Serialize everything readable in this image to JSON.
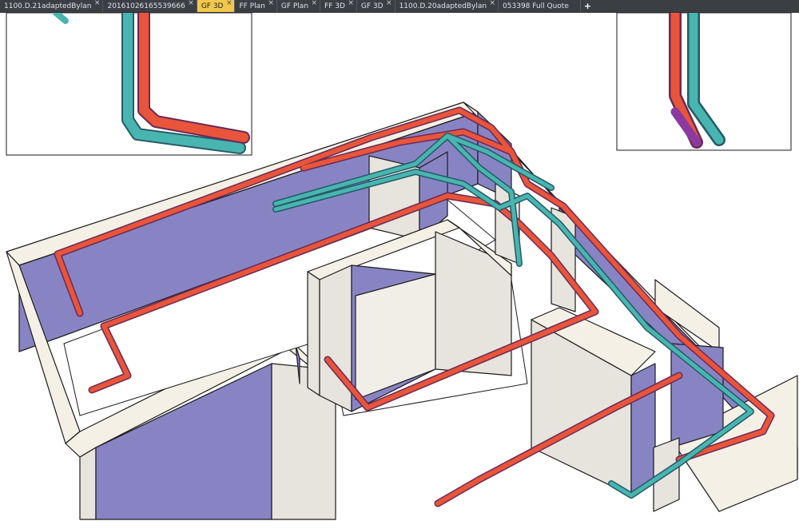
{
  "tabs": [
    {
      "label": "1100.D.21adaptedBylan",
      "active": false
    },
    {
      "label": "20161026165539666",
      "active": false
    },
    {
      "label": "GF 3D",
      "active": true
    },
    {
      "label": "FF Plan",
      "active": false
    },
    {
      "label": "GF Plan",
      "active": false
    },
    {
      "label": "FF 3D",
      "active": false
    },
    {
      "label": "GF 3D",
      "active": false
    },
    {
      "label": "1100.D.20adaptedBylan",
      "active": false
    },
    {
      "label": "053398 Full Quote",
      "active": false
    }
  ],
  "close_glyph": "×",
  "add_tab_glyph": "+",
  "icons": {
    "close": "close-icon",
    "add": "plus-icon"
  },
  "colors": {
    "tabbar_bg": "#3b3f44",
    "active_tab": "#f2c94c",
    "wall_top": "#f4f0e6",
    "wall_side": "#e6e4dc",
    "wall_face": "#8884c4",
    "hot_pipe": "#e5553a",
    "cold_pipe": "#4bb6b2",
    "pipe_outline": "#5a2a5a"
  }
}
